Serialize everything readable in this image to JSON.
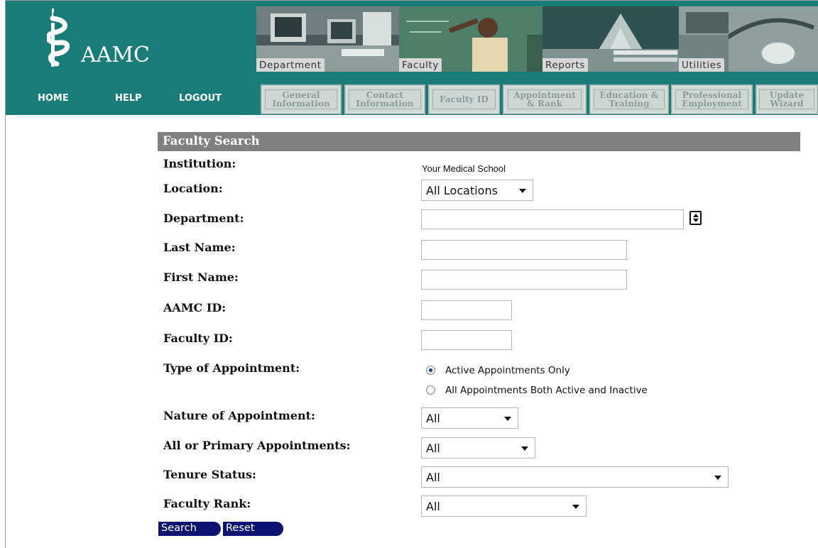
{
  "header": {
    "logo_text": "AAMC",
    "nav": {
      "home": "HOME",
      "help": "HELP",
      "logout": "LOGOUT"
    },
    "section_tabs": [
      {
        "label": "Department"
      },
      {
        "label": "Faculty"
      },
      {
        "label": "Reports"
      },
      {
        "label": "Utilities"
      }
    ],
    "sub_tabs": [
      {
        "label": "General\nInformation"
      },
      {
        "label": "Contact\nInformation"
      },
      {
        "label": "Faculty ID"
      },
      {
        "label": "Appointment\n& Rank"
      },
      {
        "label": "Education &\nTraining"
      },
      {
        "label": "Professional\nEmployment"
      },
      {
        "label": "Update\nWizard"
      }
    ]
  },
  "search": {
    "title": "Faculty Search",
    "institution_label": "Institution:",
    "institution_value": "Your Medical School",
    "location_label": "Location:",
    "location_value": "All Locations",
    "department_label": "Department:",
    "department_value": "",
    "last_name_label": "Last Name:",
    "last_name_value": "",
    "first_name_label": "First Name:",
    "first_name_value": "",
    "aamc_id_label": "AAMC ID:",
    "aamc_id_value": "",
    "faculty_id_label": "Faculty ID:",
    "faculty_id_value": "",
    "appt_type_label": "Type of Appointment:",
    "appt_type_options": [
      {
        "label": "Active Appointments Only",
        "selected": true
      },
      {
        "label": "All Appointments Both Active and Inactive",
        "selected": false
      }
    ],
    "nature_label": "Nature of Appointment:",
    "nature_value": "All",
    "all_primary_label": "All or Primary Appointments:",
    "all_primary_value": "All",
    "tenure_label": "Tenure Status:",
    "tenure_value": "All",
    "rank_label": "Faculty Rank:",
    "rank_value": "All",
    "search_button": "Search",
    "reset_button": "Reset"
  },
  "colors": {
    "header_bg": "#197c78",
    "panel_title_bg": "#808080",
    "button_bg": "#0b1270"
  }
}
